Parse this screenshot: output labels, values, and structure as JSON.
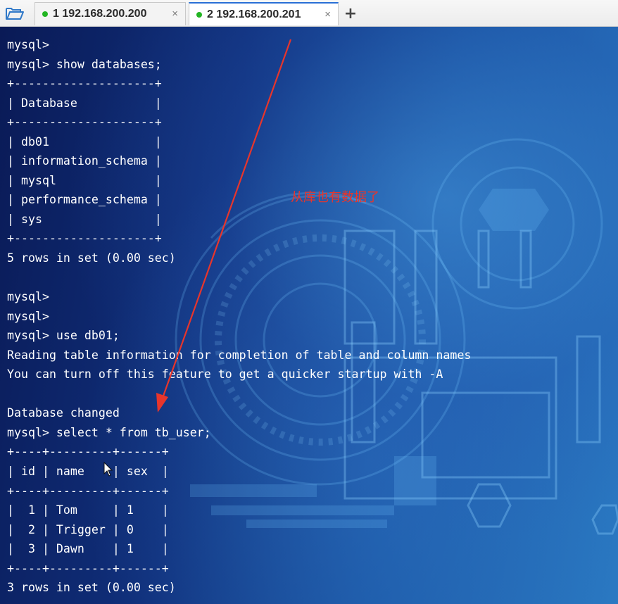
{
  "tabs": [
    {
      "label": "1 192.168.200.200",
      "status_color": "#23b523",
      "active": false
    },
    {
      "label": "2 192.168.200.201",
      "status_color": "#23b523",
      "active": true
    }
  ],
  "toolbar": {
    "open_icon": "folder-open-icon",
    "new_tab_label": "+",
    "close_glyph": "×"
  },
  "terminal": {
    "lines": [
      "mysql>",
      "mysql> show databases;",
      "+--------------------+",
      "| Database           |",
      "+--------------------+",
      "| db01               |",
      "| information_schema |",
      "| mysql              |",
      "| performance_schema |",
      "| sys                |",
      "+--------------------+",
      "5 rows in set (0.00 sec)",
      "",
      "mysql>",
      "mysql>",
      "mysql> use db01;",
      "Reading table information for completion of table and column names",
      "You can turn off this feature to get a quicker startup with -A",
      "",
      "Database changed",
      "mysql> select * from tb_user;",
      "+----+---------+------+",
      "| id | name    | sex  |",
      "+----+---------+------+",
      "|  1 | Tom     | 1    |",
      "|  2 | Trigger | 0    |",
      "|  3 | Dawn    | 1    |",
      "+----+---------+------+",
      "3 rows in set (0.00 sec)"
    ]
  },
  "annotation": {
    "text": "从库也有数据了",
    "color": "#e8352b"
  },
  "colors": {
    "terminal_text": "#ffffff",
    "tab_accent": "#2a6fd6"
  }
}
